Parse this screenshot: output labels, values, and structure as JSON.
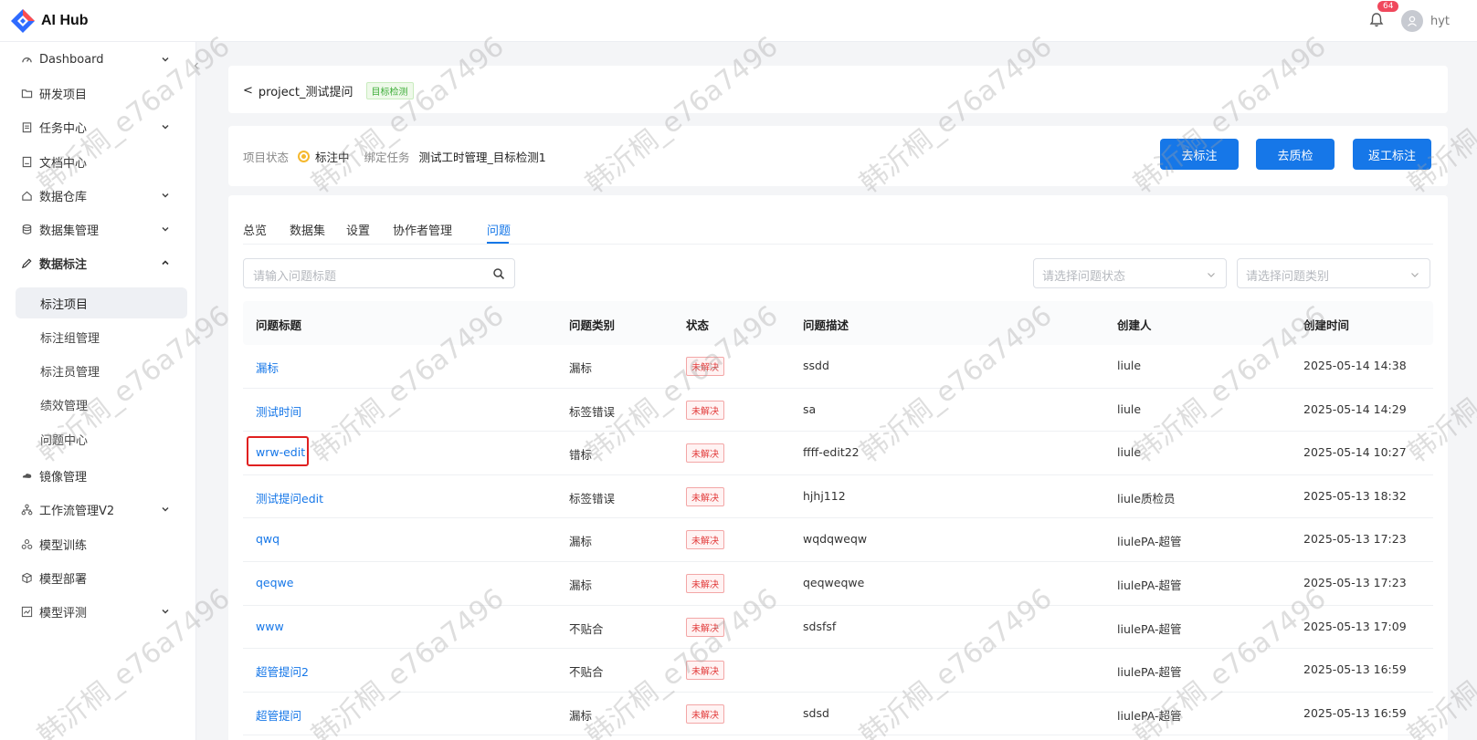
{
  "app": {
    "title": "AI Hub"
  },
  "header": {
    "notification_count": "64",
    "username": "hyt"
  },
  "sidebar": {
    "items": [
      {
        "label": "Dashboard",
        "icon": "dashboard-icon",
        "has_chevron": true
      },
      {
        "label": "研发项目",
        "icon": "folder-icon",
        "has_chevron": false
      },
      {
        "label": "任务中心",
        "icon": "clipboard-icon",
        "has_chevron": true
      },
      {
        "label": "文档中心",
        "icon": "document-icon",
        "has_chevron": false
      },
      {
        "label": "数据仓库",
        "icon": "home-icon",
        "has_chevron": true
      },
      {
        "label": "数据集管理",
        "icon": "database-icon",
        "has_chevron": true
      },
      {
        "label": "数据标注",
        "icon": "pen-icon",
        "has_chevron": true,
        "expanded": true
      },
      {
        "label": "镜像管理",
        "icon": "cloud-icon",
        "has_chevron": false
      },
      {
        "label": "工作流管理V2",
        "icon": "workflow-icon",
        "has_chevron": true
      },
      {
        "label": "模型训练",
        "icon": "training-icon",
        "has_chevron": false
      },
      {
        "label": "模型部署",
        "icon": "cube-icon",
        "has_chevron": false
      },
      {
        "label": "模型评测",
        "icon": "evaluation-icon",
        "has_chevron": true
      }
    ],
    "sub_items": [
      {
        "label": "标注项目",
        "active": true
      },
      {
        "label": "标注组管理"
      },
      {
        "label": "标注员管理"
      },
      {
        "label": "绩效管理"
      },
      {
        "label": "问题中心"
      }
    ]
  },
  "breadcrumb": {
    "back": "<",
    "title": "project_测试提问",
    "tag": "目标检测"
  },
  "project": {
    "status_label": "项目状态",
    "status_value": "标注中",
    "task_label": "绑定任务",
    "task_value": "测试工时管理_目标检测1",
    "buttons": [
      "去标注",
      "去质检",
      "返工标注"
    ]
  },
  "tabs": [
    {
      "label": "总览"
    },
    {
      "label": "数据集"
    },
    {
      "label": "设置"
    },
    {
      "label": "协作者管理"
    },
    {
      "label": "问题",
      "active": true
    }
  ],
  "filters": {
    "search_placeholder": "请输入问题标题",
    "status_placeholder": "请选择问题状态",
    "category_placeholder": "请选择问题类别"
  },
  "table": {
    "columns": [
      "问题标题",
      "问题类别",
      "状态",
      "问题描述",
      "创建人",
      "创建时间"
    ],
    "rows": [
      {
        "title": "漏标",
        "category": "漏标",
        "status": "未解决",
        "description": "ssdd",
        "creator": "liule",
        "created": "2025-05-14 14:38"
      },
      {
        "title": "测试时间",
        "category": "标签错误",
        "status": "未解决",
        "description": "sa",
        "creator": "liule",
        "created": "2025-05-14 14:29"
      },
      {
        "title": "wrw-edit",
        "category": "错标",
        "status": "未解决",
        "description": "ffff-edit22",
        "creator": "liule",
        "created": "2025-05-14 10:27",
        "highlighted": true
      },
      {
        "title": "测试提问edit",
        "category": "标签错误",
        "status": "未解决",
        "description": "hjhj112",
        "creator": "liule质检员",
        "created": "2025-05-13 18:32"
      },
      {
        "title": "qwq",
        "category": "漏标",
        "status": "未解决",
        "description": "wqdqweqw",
        "creator": "liulePA-超管",
        "created": "2025-05-13 17:23"
      },
      {
        "title": "qeqwe",
        "category": "漏标",
        "status": "未解决",
        "description": "qeqweqwe",
        "creator": "liulePA-超管",
        "created": "2025-05-13 17:23"
      },
      {
        "title": "www",
        "category": "不贴合",
        "status": "未解决",
        "description": "sdsfsf",
        "creator": "liulePA-超管",
        "created": "2025-05-13 17:09"
      },
      {
        "title": "超管提问2",
        "category": "不贴合",
        "status": "未解决",
        "description": "",
        "creator": "liulePA-超管",
        "created": "2025-05-13 16:59"
      },
      {
        "title": "超管提问",
        "category": "漏标",
        "status": "未解决",
        "description": "sdsd",
        "creator": "liulePA-超管",
        "created": "2025-05-13 16:59"
      }
    ]
  },
  "watermark": {
    "text": "韩沂桐_e76a7496"
  },
  "colors": {
    "primary": "#1677e8",
    "danger": "#e23a3a",
    "success": "#3fae3a",
    "warning": "#f5b82e"
  }
}
